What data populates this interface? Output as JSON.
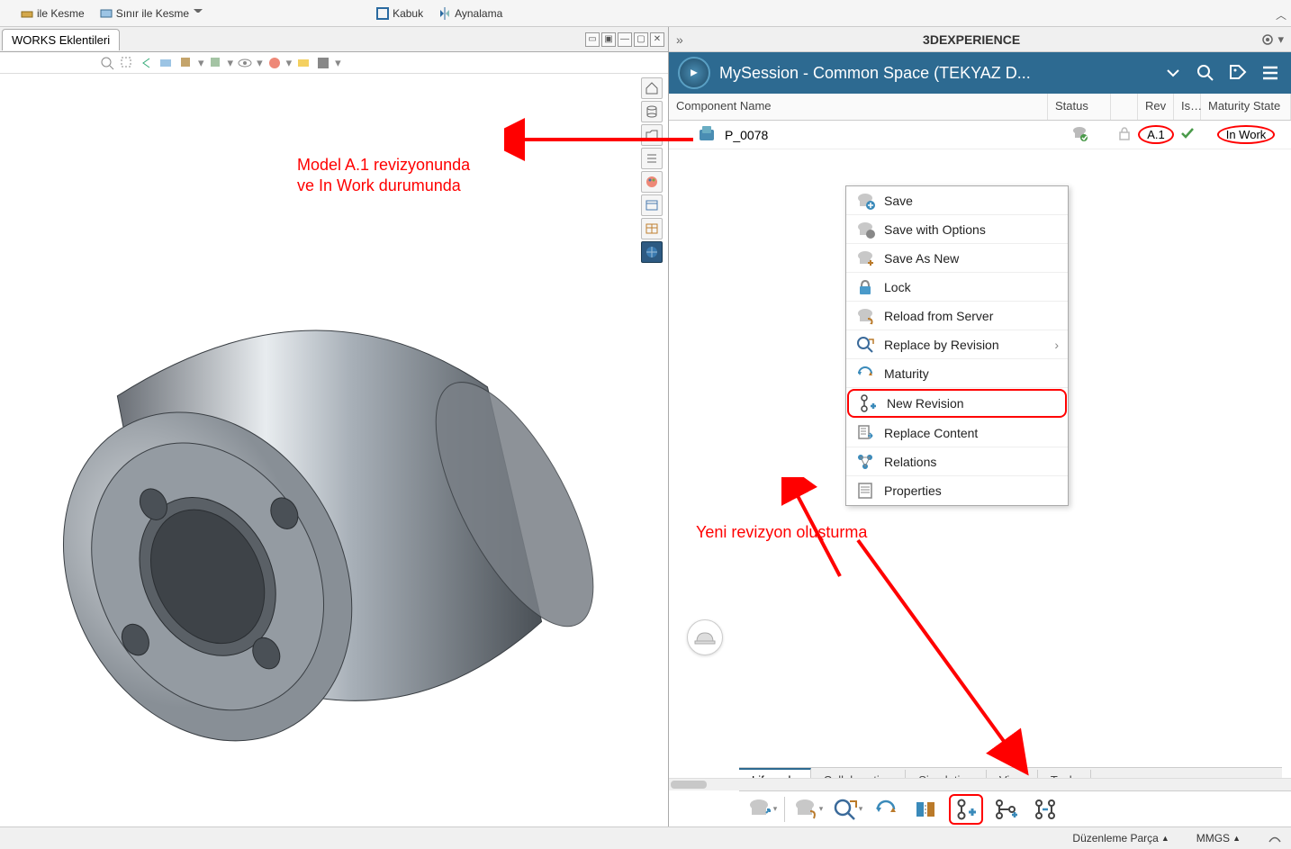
{
  "toolbar": {
    "ile_kesme": "ile Kesme",
    "sinir_ile_kesme": "Sınır ile Kesme",
    "kabuk": "Kabuk",
    "aynalama": "Aynalama"
  },
  "tab_title": "WORKS Eklentileri",
  "annotations": {
    "model_line1": "Model A.1 revizyonunda",
    "model_line2": "ve In Work durumunda",
    "new_rev": "Yeni revizyon oluşturma"
  },
  "exp_title": "3DEXPERIENCE",
  "session_title": "MySession - Common Space (TEKYAZ D...",
  "table": {
    "col_name": "Component Name",
    "col_status": "Status",
    "col_rev": "Rev",
    "col_is": "Is…",
    "col_maturity": "Maturity State",
    "row": {
      "name": "P_0078",
      "rev": "A.1",
      "maturity": "In Work"
    }
  },
  "menu": {
    "save": "Save",
    "save_options": "Save with Options",
    "save_as_new": "Save As New",
    "lock": "Lock",
    "reload": "Reload from Server",
    "replace_rev": "Replace by Revision",
    "maturity": "Maturity",
    "new_revision": "New Revision",
    "replace_content": "Replace Content",
    "relations": "Relations",
    "properties": "Properties"
  },
  "bottom_tabs": {
    "lifecycle": "Lifecycle",
    "collaboration": "Collaboration",
    "simulation": "Simulation",
    "view": "View",
    "tools": "Tools"
  },
  "status": {
    "edit": "Düzenleme Parça",
    "units": "MMGS"
  }
}
